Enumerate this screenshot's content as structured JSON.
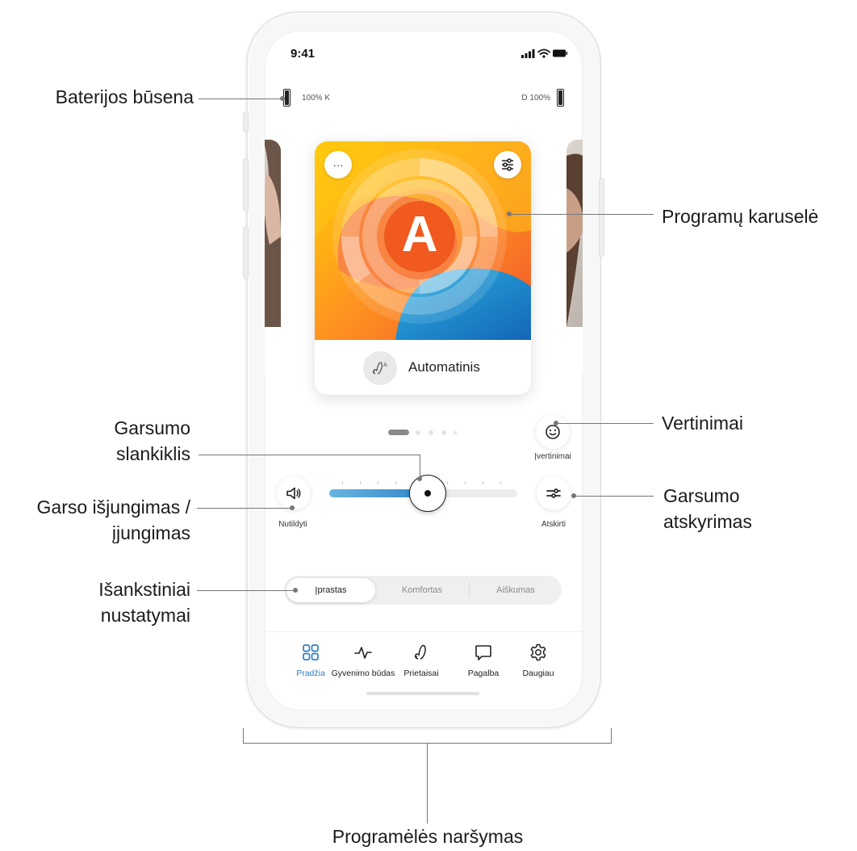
{
  "status_bar": {
    "time": "9:41"
  },
  "battery": {
    "left_text": "100% K",
    "right_text": "D 100%"
  },
  "carousel": {
    "program_letter": "A",
    "more_label": "···",
    "program_name": "Automatinis",
    "page_count": 5,
    "active_page": 1
  },
  "ratings": {
    "label": "Įvertinimai"
  },
  "volume": {
    "mute_label": "Nutildyti",
    "split_label": "Atskirti",
    "level": 0.52
  },
  "presets": {
    "items": [
      "Įprastas",
      "Komfortas",
      "Aiškumas"
    ],
    "selected": "Įprastas"
  },
  "nav": {
    "tabs": [
      {
        "label": "Pradžia",
        "icon": "grid-icon",
        "active": true
      },
      {
        "label": "Gyvenimo būdas",
        "icon": "activity-icon",
        "active": false
      },
      {
        "label": "Prietaisai",
        "icon": "hearing-aid-icon",
        "active": false
      },
      {
        "label": "Pagalba",
        "icon": "chat-icon",
        "active": false
      },
      {
        "label": "Daugiau",
        "icon": "gear-icon",
        "active": false
      }
    ]
  },
  "annotations": {
    "battery": "Baterijos būsena",
    "carousel": "Programų karuselė",
    "ratings": "Vertinimai",
    "slider_line1": "Garsumo",
    "slider_line2": "slankiklis",
    "split_line1": "Garsumo",
    "split_line2": "atskyrimas",
    "mute_line1": "Garso išjungimas /",
    "mute_line2": "įjungimas",
    "presets_line1": "Išankstiniai",
    "presets_line2": "nustatymai",
    "navigation": "Programėlės naršymas"
  },
  "colors": {
    "accent": "#2a7fc5",
    "slider_fill": "#3d92d0",
    "text": "#1b1b1b"
  }
}
